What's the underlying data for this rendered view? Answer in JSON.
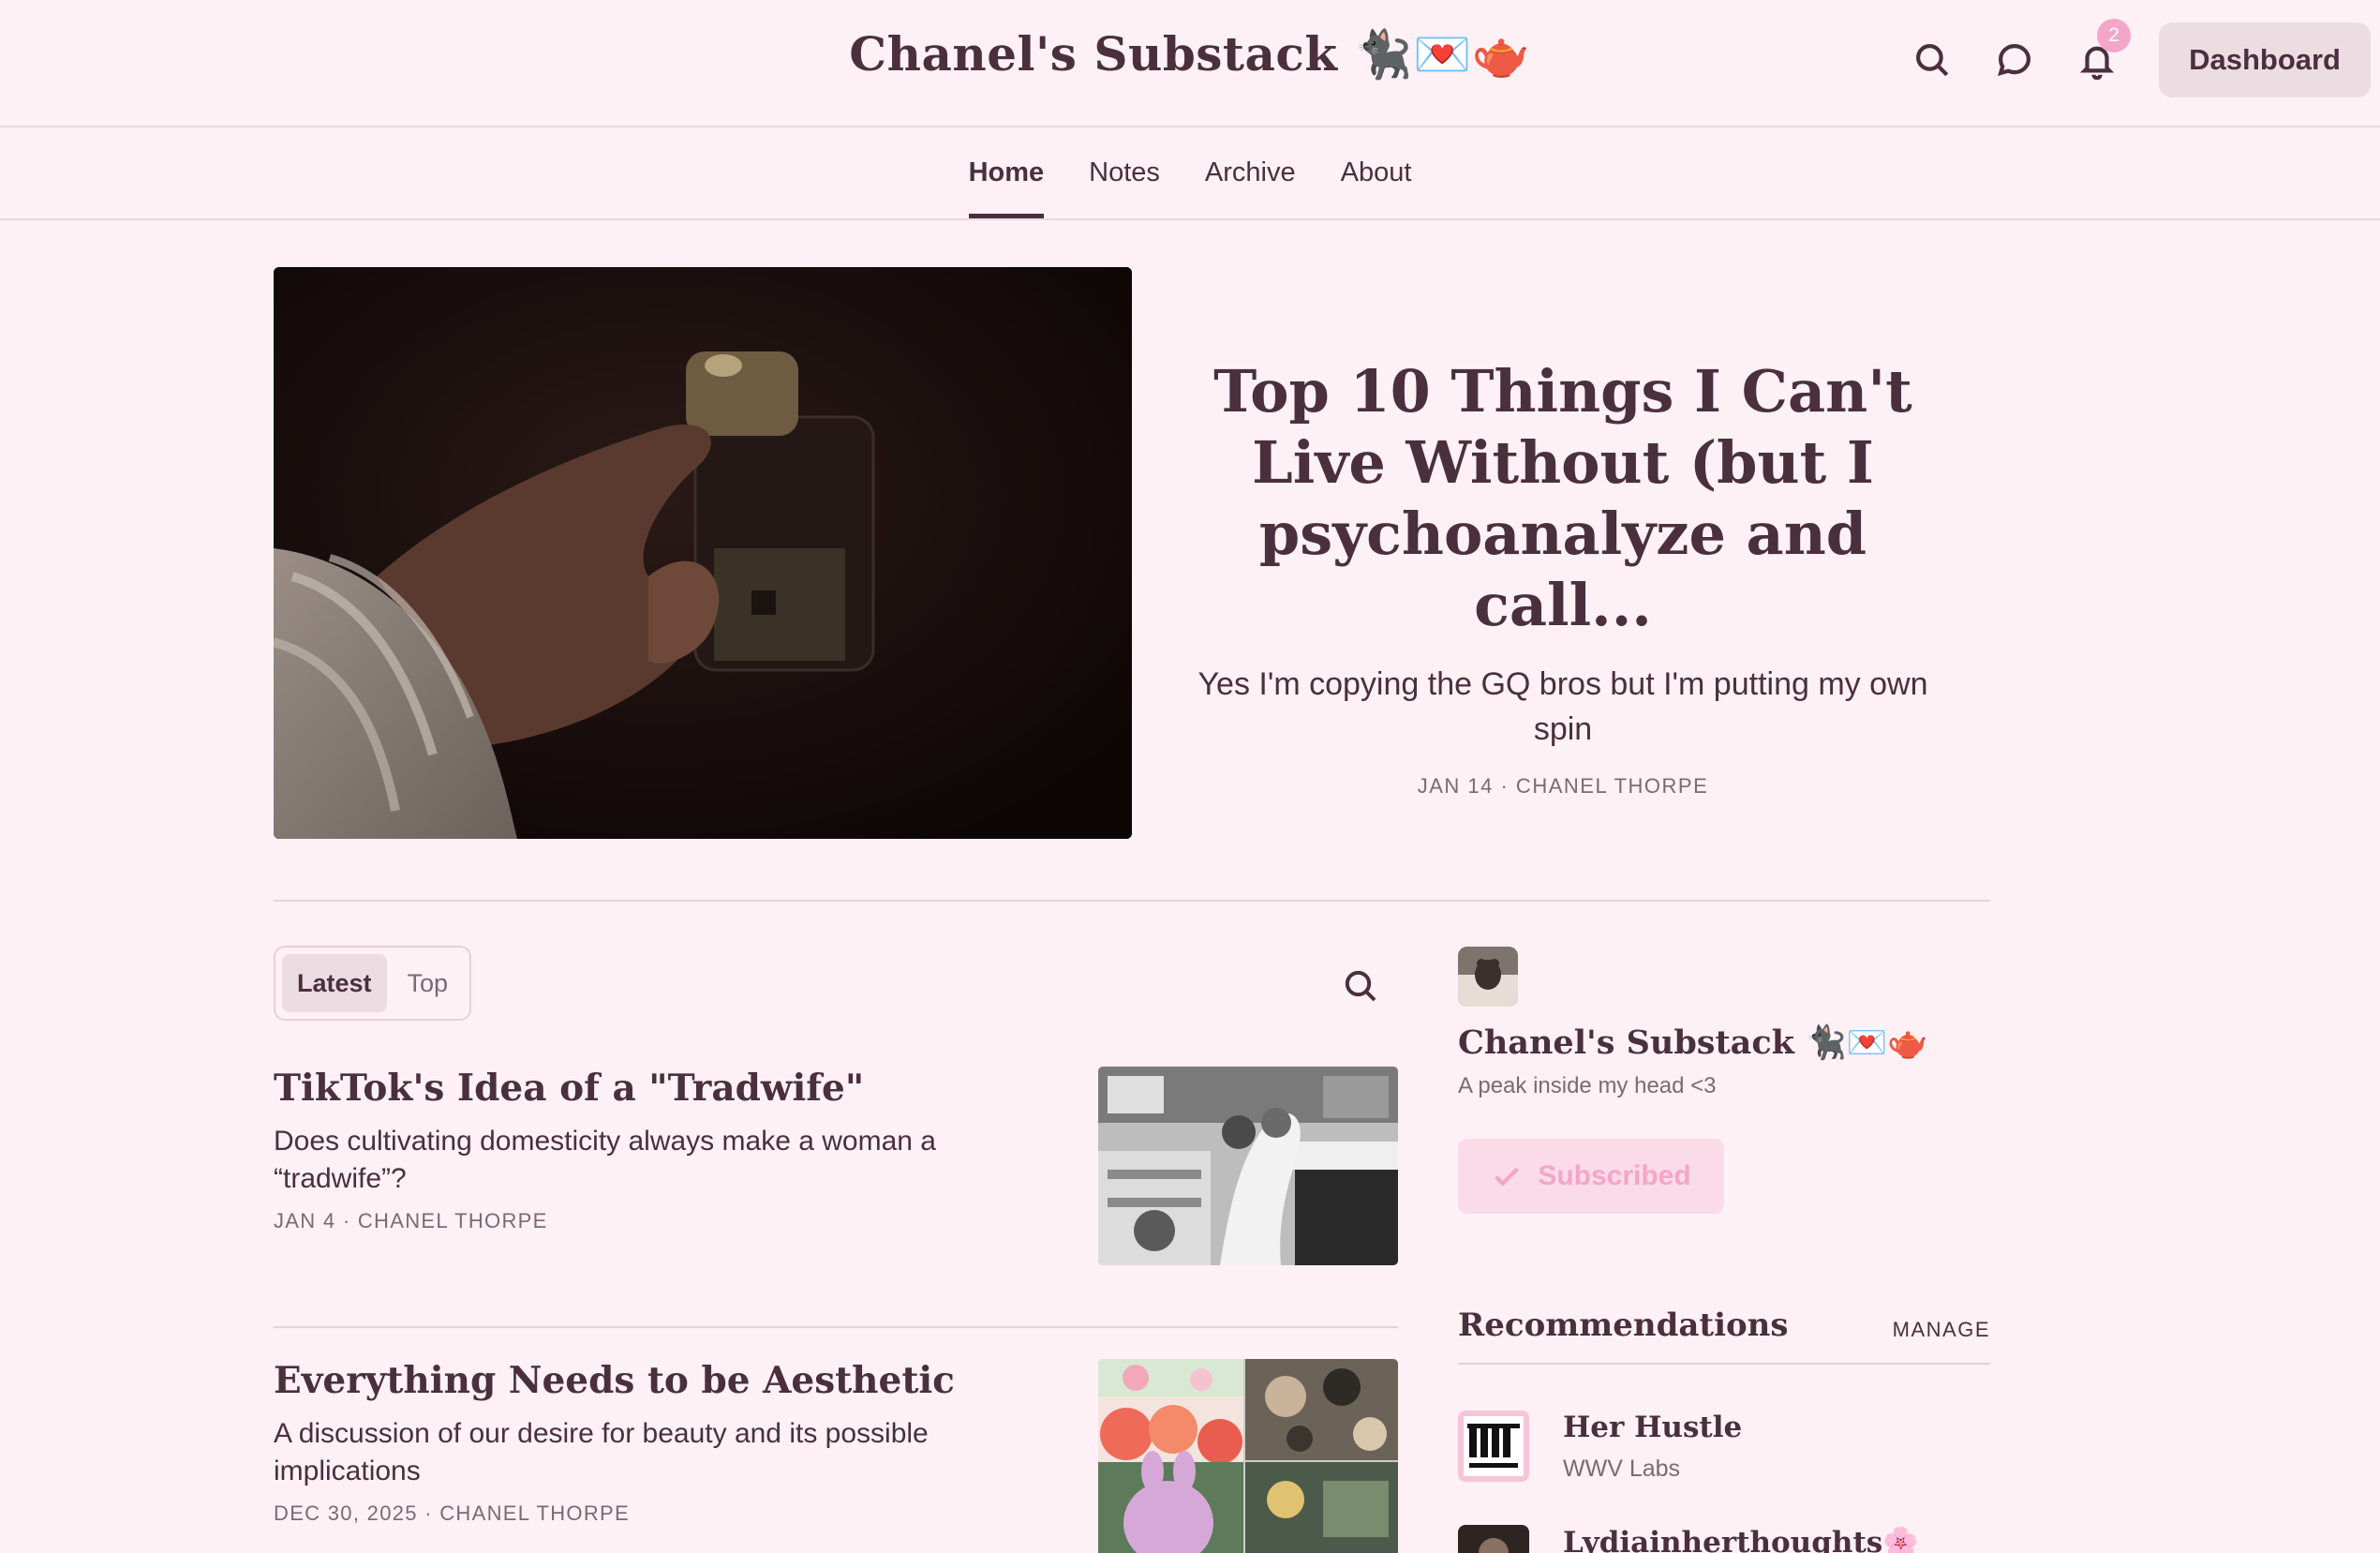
{
  "header": {
    "site_title": "Chanel's Substack 🐈‍⬛💌🫖",
    "notification_count": "2",
    "dashboard_label": "Dashboard"
  },
  "nav": {
    "tabs": [
      {
        "label": "Home",
        "active": true
      },
      {
        "label": "Notes"
      },
      {
        "label": "Archive"
      },
      {
        "label": "About"
      }
    ]
  },
  "hero": {
    "title": "Top 10 Things I Can't Live Without (but I psychoanalyze and call...",
    "subtitle": "Yes I'm copying the GQ bros but I'm putting my own spin",
    "meta": "JAN 14 · CHANEL THORPE"
  },
  "list": {
    "tabs": [
      {
        "label": "Latest",
        "active": true
      },
      {
        "label": "Top"
      }
    ],
    "posts": [
      {
        "title": "TikTok's Idea of a \"Tradwife\"",
        "subtitle": "Does cultivating domesticity always make a woman a “tradwife”?",
        "meta": "JAN 4 · CHANEL THORPE"
      },
      {
        "title": "Everything Needs to be Aesthetic",
        "subtitle": "A discussion of our desire for beauty and its possible implications",
        "meta": "DEC 30, 2025 · CHANEL THORPE"
      }
    ]
  },
  "sidebar": {
    "name": "Chanel's Substack 🐈‍⬛💌🫖",
    "description": "A peak inside my head <3",
    "subscribed_label": "Subscribed",
    "recommendations_title": "Recommendations",
    "manage_label": "MANAGE",
    "recommendations": [
      {
        "name": "Her Hustle",
        "author": "WWV Labs"
      },
      {
        "name": "Lydiainherthoughts🌸",
        "author": ""
      }
    ]
  },
  "icons": {
    "search": "search-icon",
    "comments": "chat-bubble-icon",
    "notifications": "bell-icon",
    "check": "check-icon"
  },
  "colors": {
    "background": "#fdf1f5",
    "text": "#4a2f3d",
    "accent_pink": "#f3a6c8",
    "button_bg": "#ecdde3"
  }
}
